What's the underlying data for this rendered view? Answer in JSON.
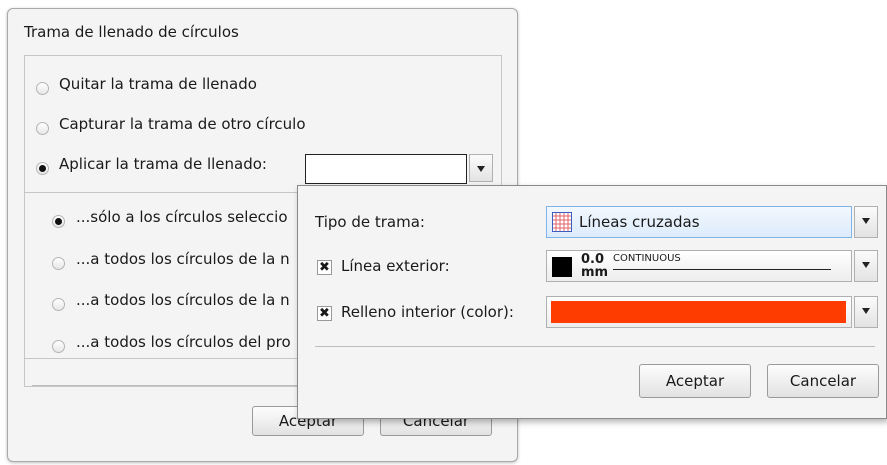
{
  "dialog": {
    "title": "Trama de llenado de círculos",
    "options": [
      {
        "label": "Quitar la trama de llenado",
        "checked": false
      },
      {
        "label": "Capturar la trama de otro círculo",
        "checked": false
      },
      {
        "label": "Aplicar la trama de llenado:",
        "checked": true
      }
    ],
    "scope_options": [
      {
        "label": "...sólo a los círculos seleccio",
        "checked": true
      },
      {
        "label": "...a todos los círculos de la n",
        "checked": false
      },
      {
        "label": "...a todos los círculos de la n",
        "checked": false
      },
      {
        "label": "...a todos los círculos del pro",
        "checked": false
      }
    ],
    "accept_label": "Aceptar",
    "cancel_label": "Cancelar"
  },
  "popup": {
    "pattern_type_label": "Tipo de trama:",
    "pattern_type_value": "Líneas cruzadas",
    "outline_label": "Línea exterior:",
    "outline_checked": true,
    "outline_weight_value": "0.0",
    "outline_weight_unit": "mm",
    "outline_linetype": "CONTINUOUS",
    "outline_color": "#000000",
    "fill_label": "Relleno interior (color):",
    "fill_checked": true,
    "fill_color": "#ff3c00",
    "accept_label": "Aceptar",
    "cancel_label": "Cancelar"
  }
}
